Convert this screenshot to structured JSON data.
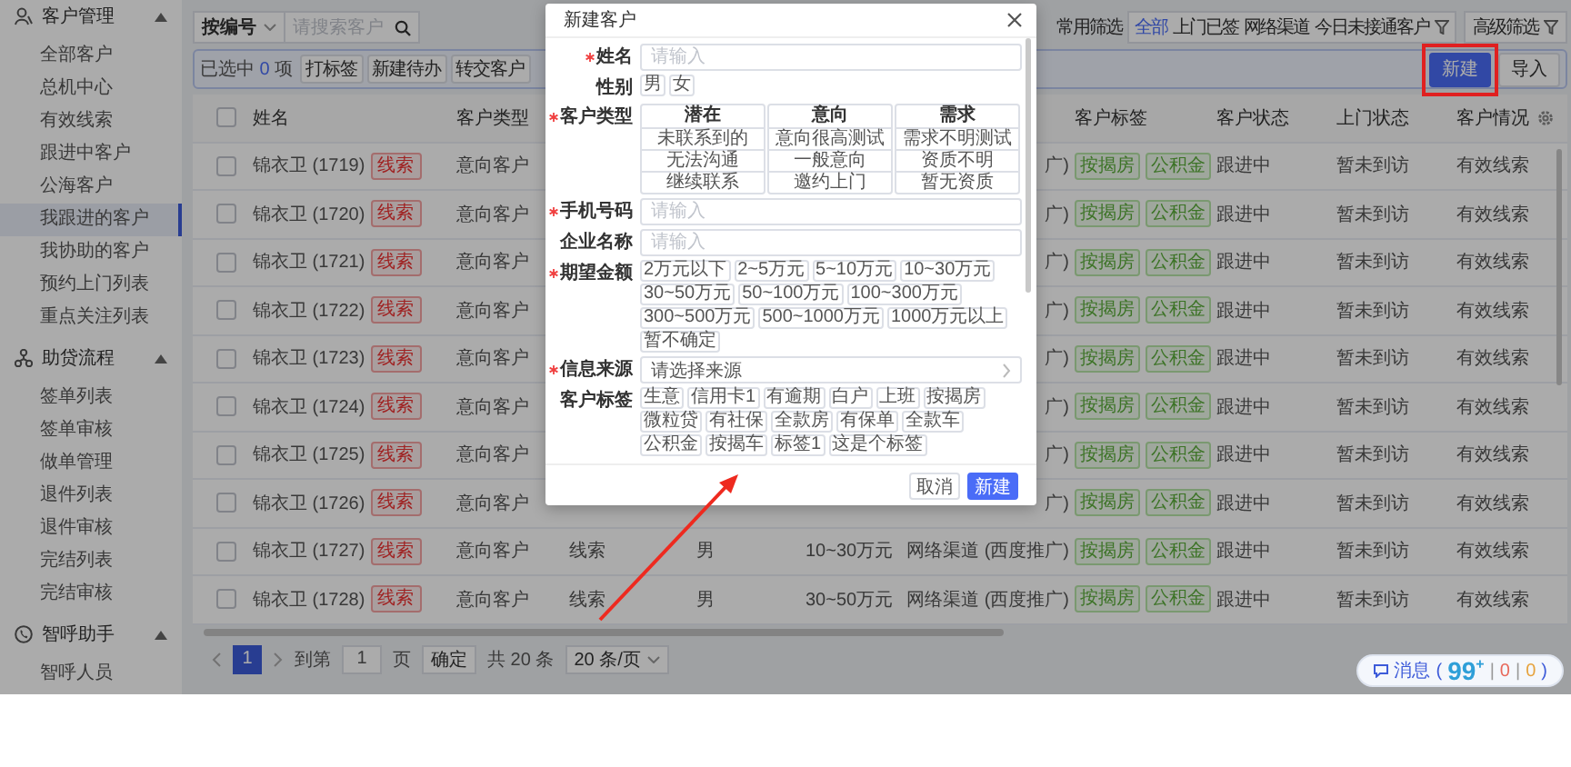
{
  "sidebar": {
    "groups": [
      {
        "title": "客户管理",
        "expanded": true,
        "items": [
          {
            "label": "全部客户",
            "selected": false
          },
          {
            "label": "总机中心",
            "selected": false
          },
          {
            "label": "有效线索",
            "selected": false
          },
          {
            "label": "跟进中客户",
            "selected": false
          },
          {
            "label": "公海客户",
            "selected": false
          },
          {
            "label": "我跟进的客户",
            "selected": true
          },
          {
            "label": "我协助的客户",
            "selected": false
          },
          {
            "label": "预约上门列表",
            "selected": false
          },
          {
            "label": "重点关注列表",
            "selected": false
          }
        ]
      },
      {
        "title": "助贷流程",
        "expanded": true,
        "items": [
          {
            "label": "签单列表",
            "selected": false
          },
          {
            "label": "签单审核",
            "selected": false
          },
          {
            "label": "做单管理",
            "selected": false
          },
          {
            "label": "退件列表",
            "selected": false
          },
          {
            "label": "退件审核",
            "selected": false
          },
          {
            "label": "完结列表",
            "selected": false
          },
          {
            "label": "完结审核",
            "selected": false
          }
        ]
      },
      {
        "title": "智呼助手",
        "expanded": true,
        "items": [
          {
            "label": "智呼人员",
            "selected": false
          }
        ]
      }
    ]
  },
  "toolbar": {
    "search_by": "按编号",
    "search_placeholder": "请搜索客户",
    "quick_filter_label": "常用筛选",
    "quick_filters": [
      {
        "label": "全部",
        "selected": true
      },
      {
        "label": "上门已签",
        "selected": false
      },
      {
        "label": "网络渠道",
        "selected": false
      },
      {
        "label": "今日未接通客户",
        "selected": false
      }
    ],
    "advanced_filter": "高级筛选"
  },
  "selection_bar": {
    "selected_prefix": "已选中",
    "selected_count": "0",
    "selected_suffix": "项",
    "actions": [
      "打标签",
      "新建待办",
      "转交客户"
    ],
    "primary": {
      "label": "新建",
      "highlighted": true
    },
    "import": "导入"
  },
  "table": {
    "select_all_checked": false,
    "columns": [
      "姓名",
      "客户类型",
      "客户标签",
      "客户状态",
      "上门状态",
      "客户情况"
    ],
    "rows": [
      {
        "checked": false,
        "name": "锦衣卫 (1719)",
        "badge": "线索",
        "type": "意向客户",
        "column_6": "广)",
        "tags": [
          "按揭房",
          "公积金"
        ],
        "status": "跟进中",
        "visit": "暂未到访",
        "situation": "有效线索"
      },
      {
        "checked": false,
        "name": "锦衣卫 (1720)",
        "badge": "线索",
        "type": "意向客户",
        "column_6": "广)",
        "tags": [
          "按揭房",
          "公积金"
        ],
        "status": "跟进中",
        "visit": "暂未到访",
        "situation": "有效线索"
      },
      {
        "checked": false,
        "name": "锦衣卫 (1721)",
        "badge": "线索",
        "type": "意向客户",
        "column_6": "广)",
        "tags": [
          "按揭房",
          "公积金"
        ],
        "status": "跟进中",
        "visit": "暂未到访",
        "situation": "有效线索"
      },
      {
        "checked": false,
        "name": "锦衣卫 (1722)",
        "badge": "线索",
        "type": "意向客户",
        "column_6": "广)",
        "tags": [
          "按揭房",
          "公积金"
        ],
        "status": "跟进中",
        "visit": "暂未到访",
        "situation": "有效线索"
      },
      {
        "checked": false,
        "name": "锦衣卫 (1723)",
        "badge": "线索",
        "type": "意向客户",
        "column_6": "广)",
        "tags": [
          "按揭房",
          "公积金"
        ],
        "status": "跟进中",
        "visit": "暂未到访",
        "situation": "有效线索"
      },
      {
        "checked": false,
        "name": "锦衣卫 (1724)",
        "badge": "线索",
        "type": "意向客户",
        "column_6": "广)",
        "tags": [
          "按揭房",
          "公积金"
        ],
        "status": "跟进中",
        "visit": "暂未到访",
        "situation": "有效线索"
      },
      {
        "checked": false,
        "name": "锦衣卫 (1725)",
        "badge": "线索",
        "type": "意向客户",
        "column_6": "广)",
        "tags": [
          "按揭房",
          "公积金"
        ],
        "status": "跟进中",
        "visit": "暂未到访",
        "situation": "有效线索"
      },
      {
        "checked": false,
        "name": "锦衣卫 (1726)",
        "badge": "线索",
        "type": "意向客户",
        "column_6": "广)",
        "tags": [
          "按揭房",
          "公积金"
        ],
        "status": "跟进中",
        "visit": "暂未到访",
        "situation": "有效线索"
      },
      {
        "checked": false,
        "name": "锦衣卫 (1727)",
        "badge": "线索",
        "type": "意向客户",
        "column_3": "线索",
        "column_4": "男",
        "column_5": "10~30万元",
        "column_6": "网络渠道 (西度推广)",
        "tags": [
          "按揭房",
          "公积金"
        ],
        "status": "跟进中",
        "visit": "暂未到访",
        "situation": "有效线索"
      },
      {
        "checked": false,
        "name": "锦衣卫 (1728)",
        "badge": "线索",
        "type": "意向客户",
        "column_3": "线索",
        "column_4": "男",
        "column_5": "30~50万元",
        "column_6": "网络渠道 (西度推广)",
        "tags": [
          "按揭房",
          "公积金"
        ],
        "status": "跟进中",
        "visit": "暂未到访",
        "situation": "有效线索"
      }
    ]
  },
  "pagination": {
    "pages": [
      {
        "label": "1",
        "selected": true
      }
    ],
    "goto_label": "到第",
    "goto_value": "1",
    "page_unit": "页",
    "confirm": "确定",
    "total": "共 20 条",
    "page_size": "20 条/页"
  },
  "messages": {
    "label": "消息",
    "open": "(",
    "count": "99",
    "count_suffix": "+",
    "counters": [
      {
        "separator": "|",
        "value": "0",
        "color": "#e8685a"
      },
      {
        "separator": "|",
        "value": "0",
        "color": "#e6a23c"
      }
    ],
    "close": ")"
  },
  "dialog": {
    "title": "新建客户",
    "fields": [
      {
        "kind": "input",
        "label": "姓名",
        "required": true,
        "placeholder": "请输入"
      },
      {
        "kind": "chips",
        "label": "性别",
        "required": false,
        "options": [
          {
            "label": "男",
            "selected": false
          },
          {
            "label": "女",
            "selected": false
          }
        ]
      },
      {
        "kind": "type_grid",
        "label": "客户类型",
        "required": true,
        "groups": [
          {
            "title": "潜在",
            "options": [
              {
                "label": "未联系到的",
                "selected": false
              },
              {
                "label": "无法沟通",
                "selected": false
              },
              {
                "label": "继续联系",
                "selected": false
              }
            ]
          },
          {
            "title": "意向",
            "options": [
              {
                "label": "意向很高测试",
                "selected": false
              },
              {
                "label": "一般意向",
                "selected": false
              },
              {
                "label": "邀约上门",
                "selected": false
              }
            ]
          },
          {
            "title": "需求",
            "options": [
              {
                "label": "需求不明测试",
                "selected": false
              },
              {
                "label": "资质不明",
                "selected": false
              },
              {
                "label": "暂无资质",
                "selected": false
              }
            ]
          }
        ]
      },
      {
        "kind": "input",
        "label": "手机号码",
        "required": true,
        "placeholder": "请输入"
      },
      {
        "kind": "input",
        "label": "企业名称",
        "required": false,
        "placeholder": "请输入"
      },
      {
        "kind": "chips",
        "label": "期望金额",
        "required": true,
        "options": [
          {
            "label": "2万元以下",
            "selected": false
          },
          {
            "label": "2~5万元",
            "selected": false
          },
          {
            "label": "5~10万元",
            "selected": false
          },
          {
            "label": "10~30万元",
            "selected": false
          },
          {
            "label": "30~50万元",
            "selected": false
          },
          {
            "label": "50~100万元",
            "selected": false
          },
          {
            "label": "100~300万元",
            "selected": false
          },
          {
            "label": "300~500万元",
            "selected": false
          },
          {
            "label": "500~1000万元",
            "selected": false
          },
          {
            "label": "1000万元以上",
            "selected": false
          },
          {
            "label": "暂不确定",
            "selected": false
          }
        ]
      },
      {
        "kind": "select",
        "label": "信息来源",
        "required": true,
        "placeholder": "请选择来源"
      },
      {
        "kind": "chips",
        "label": "客户标签",
        "required": false,
        "options": [
          {
            "label": "生意",
            "selected": false
          },
          {
            "label": "信用卡1",
            "selected": false
          },
          {
            "label": "有逾期",
            "selected": false
          },
          {
            "label": "白户",
            "selected": false
          },
          {
            "label": "上班",
            "selected": false
          },
          {
            "label": "按揭房",
            "selected": false
          },
          {
            "label": "微粒贷",
            "selected": false
          },
          {
            "label": "有社保",
            "selected": false
          },
          {
            "label": "全款房",
            "selected": false
          },
          {
            "label": "有保单",
            "selected": false
          },
          {
            "label": "全款车",
            "selected": false
          },
          {
            "label": "公积金",
            "selected": false
          },
          {
            "label": "按揭车",
            "selected": false
          },
          {
            "label": "标签1",
            "selected": false
          },
          {
            "label": "这是个标签",
            "selected": false
          }
        ]
      }
    ],
    "buttons": [
      {
        "kind": "secondary",
        "label": "取消"
      },
      {
        "kind": "primary",
        "label": "新建"
      }
    ]
  }
}
